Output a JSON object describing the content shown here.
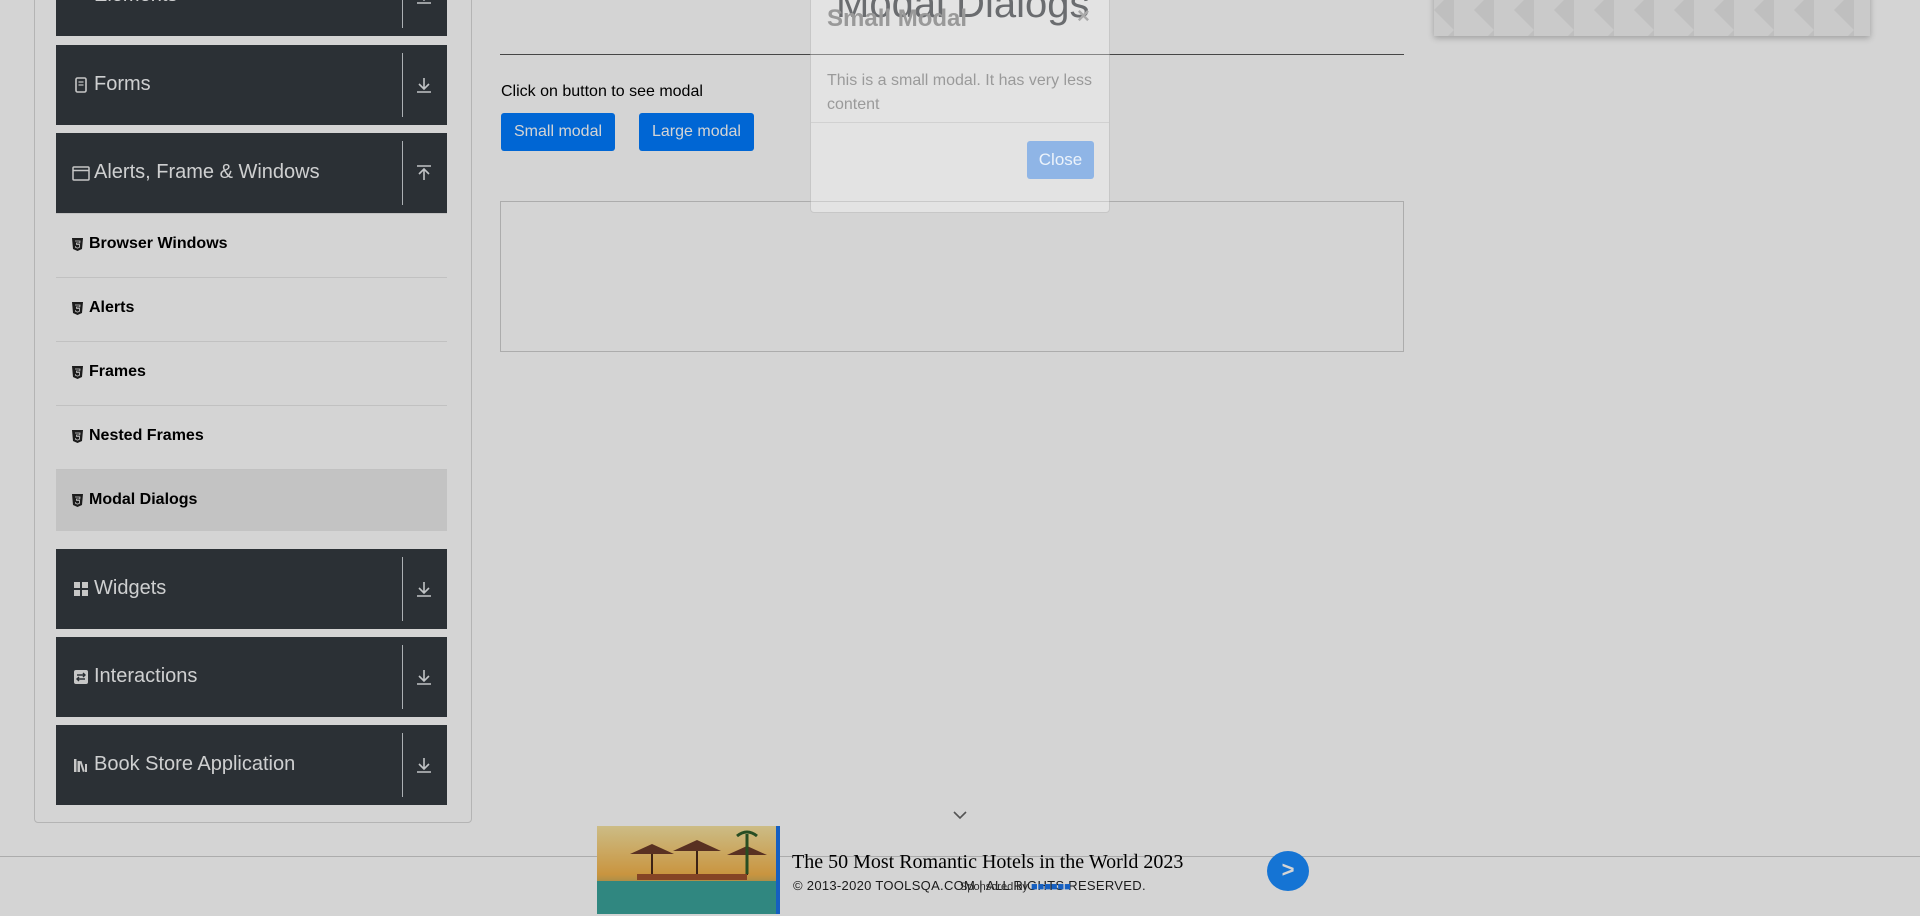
{
  "sidebar": {
    "groups": [
      {
        "label": "Elements",
        "icon": "list-icon",
        "toggle": "download-icon"
      },
      {
        "label": "Forms",
        "icon": "form-icon",
        "toggle": "download-icon"
      },
      {
        "label": "Alerts, Frame & Windows",
        "icon": "window-icon",
        "toggle": "upload-icon"
      },
      {
        "label": "Widgets",
        "icon": "widgets-icon",
        "toggle": "download-icon"
      },
      {
        "label": "Interactions",
        "icon": "interactions-icon",
        "toggle": "download-icon"
      },
      {
        "label": "Book Store Application",
        "icon": "books-icon",
        "toggle": "download-icon"
      }
    ],
    "alerts_items": [
      {
        "label": "Browser Windows"
      },
      {
        "label": "Alerts"
      },
      {
        "label": "Frames"
      },
      {
        "label": "Nested Frames"
      },
      {
        "label": "Modal Dialogs"
      }
    ],
    "active_item": "Modal Dialogs"
  },
  "main": {
    "page_title": "Modal Dialogs",
    "instruction": "Click on button to see modal",
    "small_modal_button": "Small modal",
    "large_modal_button": "Large modal"
  },
  "modal": {
    "title": "Small Modal",
    "close_x": "×",
    "body": "This is a small modal. It has very less content",
    "close_button": "Close"
  },
  "footer": {
    "copyright": "© 2013-2020 TOOLSQA.COM | ALL RIGHTS RESERVED."
  },
  "ad": {
    "headline": "The 50 Most Romantic Hotels in the World 2023",
    "sponsored_by": "Sponsored by",
    "next_label": ">"
  },
  "colors": {
    "primary": "#007bff",
    "sidebar_header": "#343a40",
    "backdrop": "rgba(0,0,0,0.17)"
  }
}
